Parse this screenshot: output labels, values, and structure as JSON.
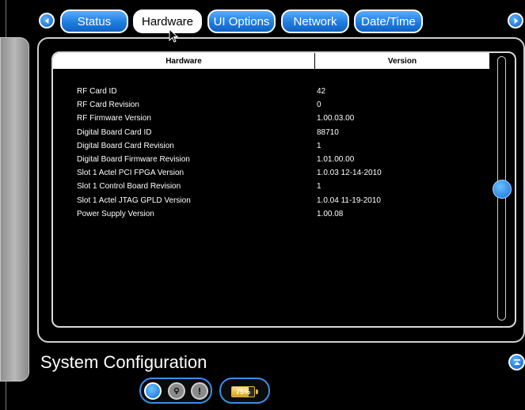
{
  "tabs": [
    {
      "label": "Status",
      "active": false
    },
    {
      "label": "Hardware",
      "active": true
    },
    {
      "label": "UI Options",
      "active": false
    },
    {
      "label": "Network",
      "active": false
    },
    {
      "label": "Date/Time",
      "active": false
    }
  ],
  "table": {
    "headers": {
      "hardware": "Hardware",
      "version": "Version"
    },
    "rows": [
      {
        "name": "RF Card ID",
        "value": "42"
      },
      {
        "name": "RF Card Revision",
        "value": "0"
      },
      {
        "name": "RF Firmware Version",
        "value": "1.00.03.00"
      },
      {
        "name": "Digital Board Card ID",
        "value": "88710"
      },
      {
        "name": "Digital Board Card Revision",
        "value": "1"
      },
      {
        "name": "Digital Board Firmware Revision",
        "value": "1.01.00.00"
      },
      {
        "name": "Slot 1 Actel PCI FPGA Version",
        "value": "1.0.03 12-14-2010"
      },
      {
        "name": "Slot 1 Control Board Revision",
        "value": "1"
      },
      {
        "name": "Slot 1 Actel JTAG GPLD Version",
        "value": "1.0.04 11-19-2010"
      },
      {
        "name": "Power Supply Version",
        "value": "1.00.08"
      }
    ]
  },
  "footer": {
    "title": "System Configuration",
    "battery_label": "75%",
    "battery_level": 0.75,
    "status_icons": [
      "radio-selected-icon",
      "lock-icon",
      "alert-icon"
    ]
  },
  "icons": {
    "prev": "left-arrow-icon",
    "next": "right-arrow-icon",
    "collapse": "collapse-up-icon"
  },
  "colors": {
    "accent": "#1f7de0",
    "background": "#000000",
    "battery": "#e0b64a"
  }
}
